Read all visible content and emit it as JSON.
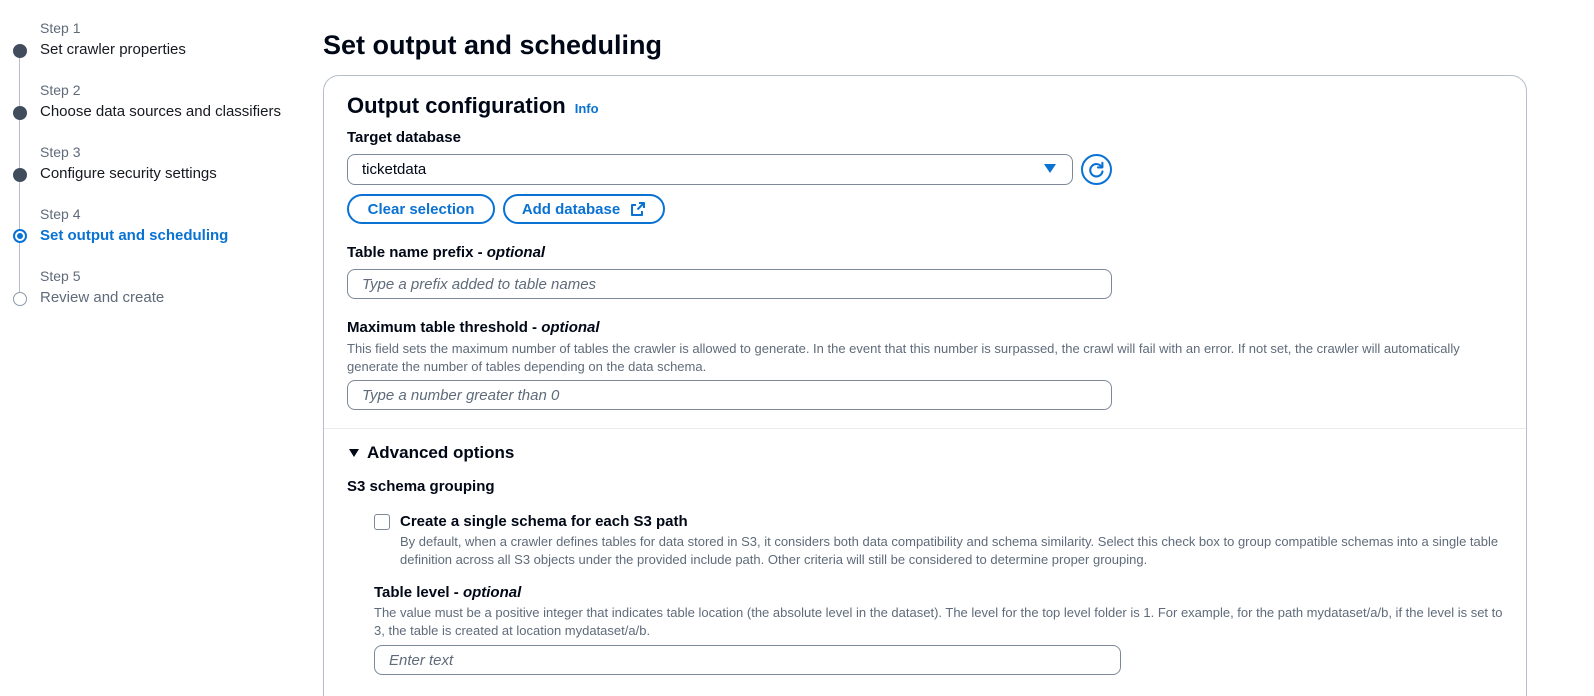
{
  "page_title": "Set output and scheduling",
  "steps": [
    {
      "number": "Step 1",
      "title": "Set crawler properties",
      "state": "done"
    },
    {
      "number": "Step 2",
      "title": "Choose data sources and classifiers",
      "state": "done"
    },
    {
      "number": "Step 3",
      "title": "Configure security settings",
      "state": "done"
    },
    {
      "number": "Step 4",
      "title": "Set output and scheduling",
      "state": "current"
    },
    {
      "number": "Step 5",
      "title": "Review and create",
      "state": "pending"
    }
  ],
  "output_config": {
    "heading": "Output configuration",
    "info_link": "Info",
    "target_database": {
      "label": "Target database",
      "value": "ticketdata",
      "clear_button": "Clear selection",
      "add_button": "Add database"
    },
    "table_prefix": {
      "label": "Table name prefix -",
      "optional": "optional",
      "placeholder": "Type a prefix added to table names"
    },
    "max_threshold": {
      "label": "Maximum table threshold -",
      "optional": "optional",
      "description": "This field sets the maximum number of tables the crawler is allowed to generate. In the event that this number is surpassed, the crawl will fail with an error. If not set, the crawler will automatically generate the number of tables depending on the data schema.",
      "placeholder": "Type a number greater than 0"
    }
  },
  "advanced": {
    "heading": "Advanced options",
    "s3_grouping_label": "S3 schema grouping",
    "single_schema": {
      "label": "Create a single schema for each S3 path",
      "checked": false,
      "description": "By default, when a crawler defines tables for data stored in S3, it considers both data compatibility and schema similarity. Select this check box to group compatible schemas into a single table definition across all S3 objects under the provided include path. Other criteria will still be considered to determine proper grouping."
    },
    "table_level": {
      "label": "Table level -",
      "optional": "optional",
      "description": "The value must be a positive integer that indicates table location (the absolute level in the dataset). The level for the top level folder is 1. For example, for the path mydataset/a/b, if the level is set to 3, the table is created at location mydataset/a/b.",
      "placeholder": "Enter text"
    }
  },
  "colors": {
    "accent": "#0972d3",
    "text": "#000716",
    "muted": "#5f6b7a",
    "border": "#7d8998"
  }
}
